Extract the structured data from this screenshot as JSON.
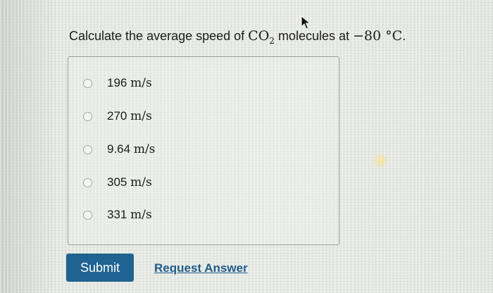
{
  "question": {
    "prefix": "Calculate the average speed of ",
    "molecule_main": "CO",
    "molecule_sub": "2",
    "middle": " molecules at ",
    "temperature": "−80 °C",
    "period": "."
  },
  "options": [
    {
      "value": "196",
      "unit": "m/s"
    },
    {
      "value": "270",
      "unit": "m/s"
    },
    {
      "value": "9.64",
      "unit": "m/s"
    },
    {
      "value": "305",
      "unit": "m/s"
    },
    {
      "value": "331",
      "unit": "m/s"
    }
  ],
  "actions": {
    "submit_label": "Submit",
    "request_label": "Request Answer"
  },
  "colors": {
    "submit_bg": "#1e6391",
    "link": "#1f5c8a"
  },
  "icons": {
    "cursor": "mouse-pointer-icon"
  }
}
